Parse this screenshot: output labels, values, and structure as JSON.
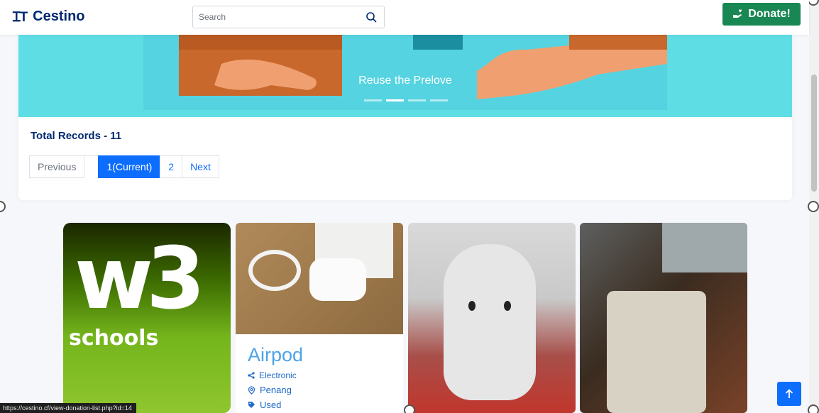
{
  "header": {
    "logo_mark": "ꞮT",
    "logo_text": "Cestino",
    "search_placeholder": "Search",
    "donate_label": "Donate!"
  },
  "banner": {
    "caption": "Reuse the Prelove",
    "indicators": 4,
    "active_indicator": 2
  },
  "records": {
    "total_label": "Total Records - 11"
  },
  "pagination": {
    "previous": "Previous",
    "current": "1(Current)",
    "page2": "2",
    "next": "Next"
  },
  "items": [
    {
      "image": "w3schools-logo",
      "w3_big": "w3",
      "w3_text": "schools"
    },
    {
      "image": "airpods-photo",
      "title": "Airpod",
      "category": "Electronic",
      "location": "Penang",
      "condition": "Used"
    },
    {
      "image": "elephant-plush-photo"
    },
    {
      "image": "powerbank-photo"
    }
  ],
  "status_bar": {
    "url": "https://cestino.cf/view-donation-list.php?id=14"
  },
  "colors": {
    "brand": "#012970",
    "donate": "#198754",
    "primary": "#0d6efd",
    "banner": "#5fdde5"
  }
}
